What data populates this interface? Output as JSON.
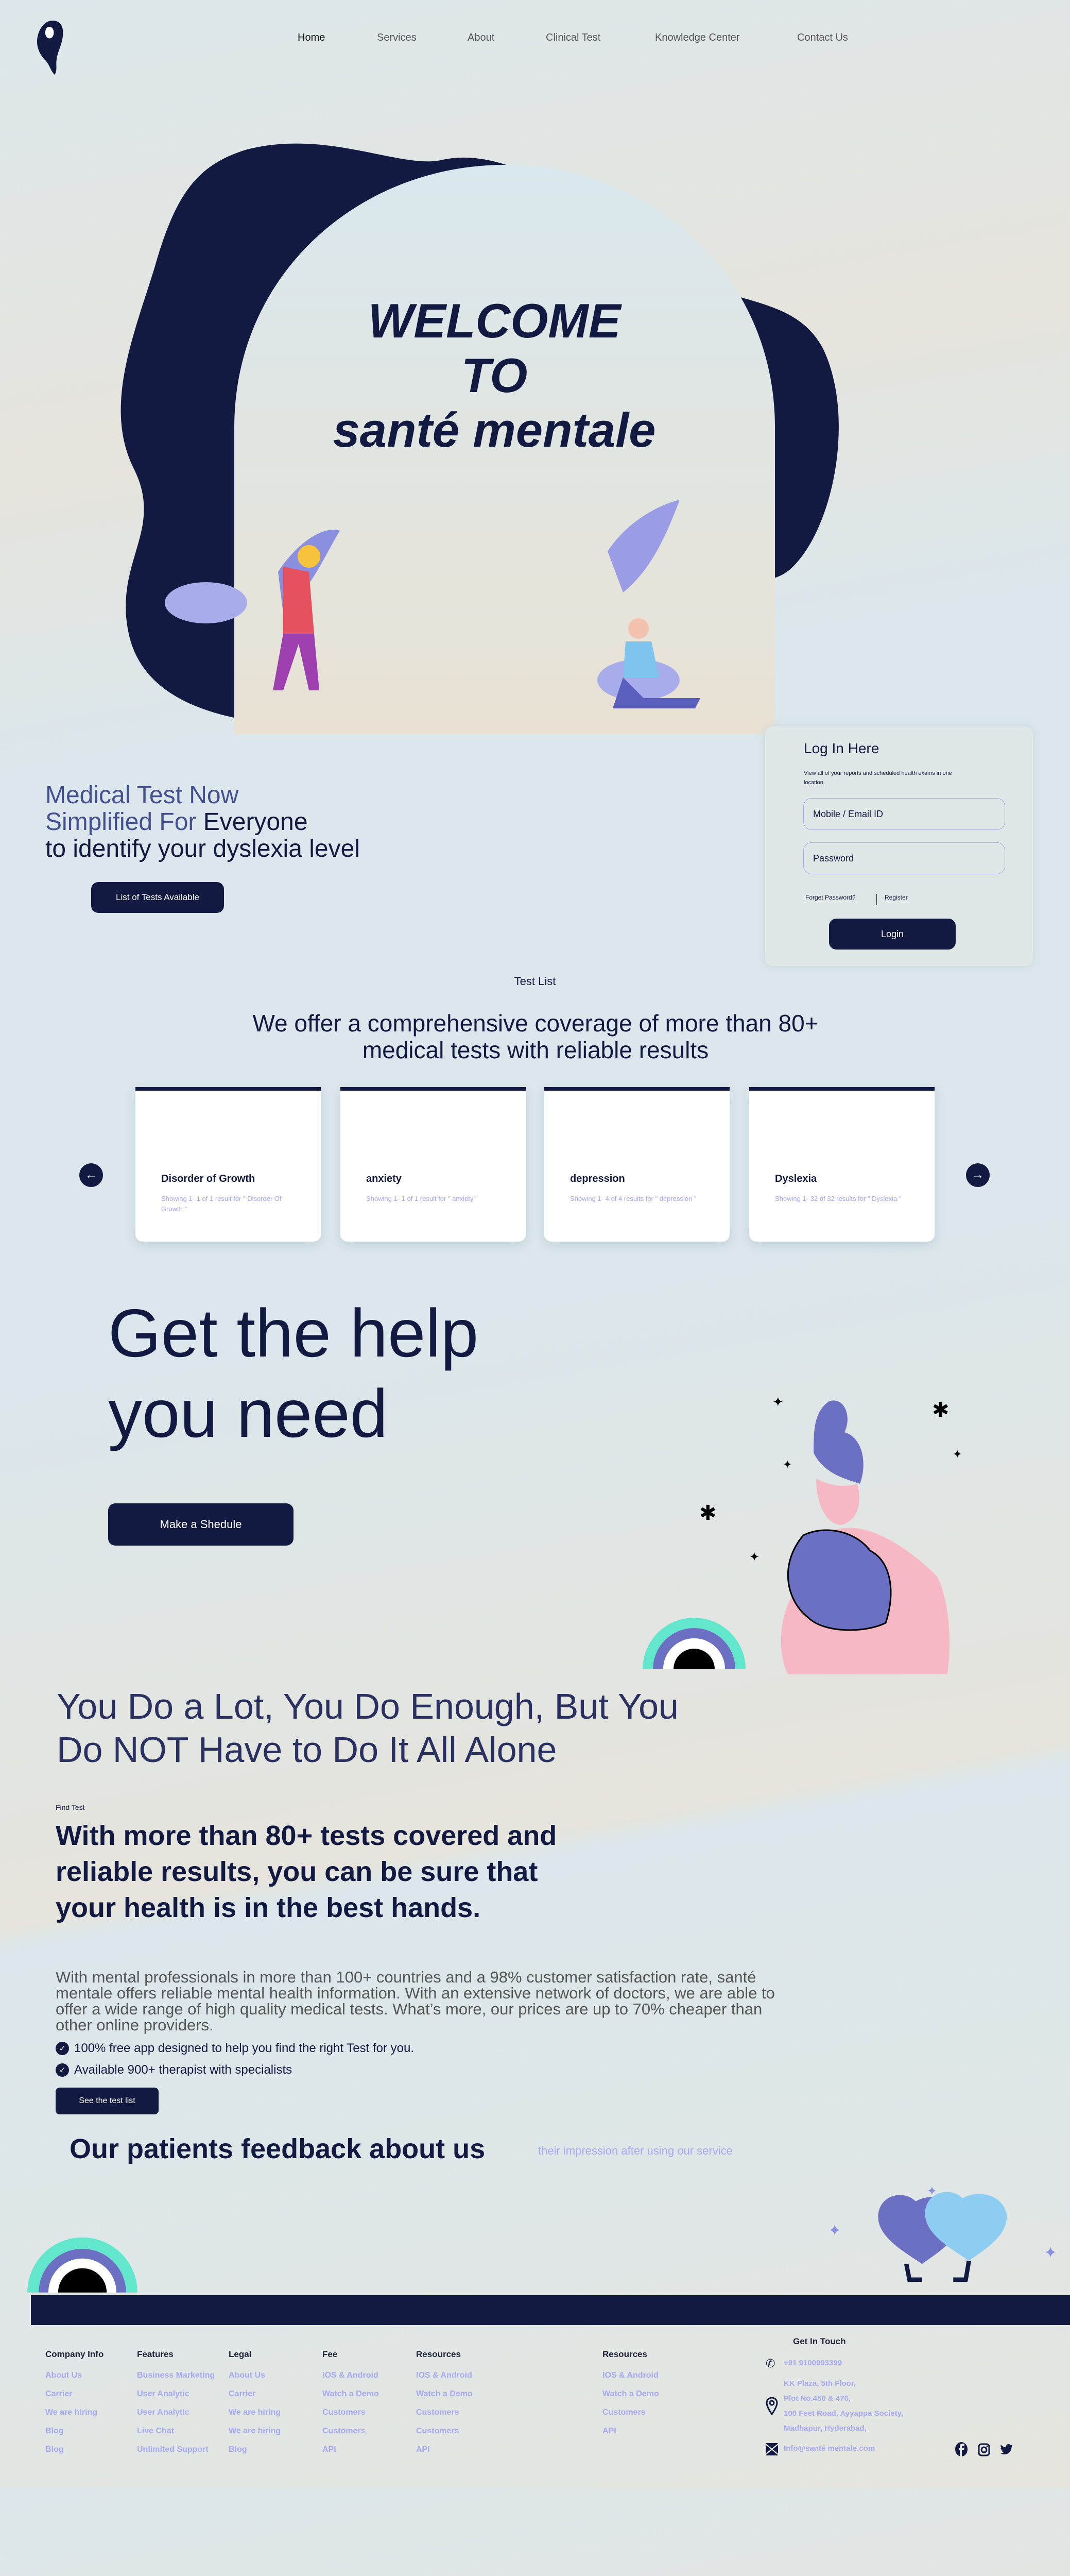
{
  "nav": {
    "items": [
      "Home",
      "Services",
      "About",
      "Clinical Test",
      "Knowledge Center",
      "Contact Us"
    ],
    "active": "Home"
  },
  "hero": {
    "line1": "WELCOME",
    "line2": "TO",
    "line3": "santé mentale"
  },
  "intro": {
    "accent": "Medical Test Now",
    "accent2": "Simplified For",
    "rest": "Everyone",
    "line3": "to identify your dyslexia level",
    "button": "List of Tests Available"
  },
  "login": {
    "title": "Log In Here",
    "subtitle": "View all of your reports and scheduled health exams in one location.",
    "email_placeholder": "Mobile / Email ID",
    "password_placeholder": "Password",
    "forgot": "Forget Password?",
    "register": "Register",
    "button": "Login"
  },
  "tests": {
    "label": "Test List",
    "heading": "We offer a comprehensive coverage of more than 80+ medical tests with reliable results",
    "cards": [
      {
        "title": "Disorder of Growth",
        "summary": "Showing 1- 1 of 1 result for \" Disorder Of Growth \""
      },
      {
        "title": "anxiety",
        "summary": "Showing 1- 1 of 1 result for \" anxiety \""
      },
      {
        "title": "depression",
        "summary": "Showing 1- 4 of 4 results for \" depression \""
      },
      {
        "title": "Dyslexia",
        "summary": "Showing 1- 32 of 32 results for \" Dyslexia \""
      }
    ]
  },
  "help": {
    "line1": "Get the help",
    "line2": "you need",
    "button": "Make a Shedule",
    "tagline": "You Do a Lot, You Do Enough, But You Do NOT Have to Do It All Alone"
  },
  "find": {
    "label": "Find Test",
    "heading": "With more than 80+ tests covered and reliable results, you can be sure that your health is in the best hands.",
    "body": "With mental  professionals in more than 100+ countries and a 98% customer satisfaction rate, santé mentale offers reliable mental health information. With an extensive network of doctors, we are able to offer a wide range of high quality medical tests. What’s more, our prices are up to 70% cheaper than other online providers.",
    "checks": [
      "100% free app designed to help you find the right Test for you.",
      "Available 900+ therapist with  specialists"
    ],
    "button": "See the test list"
  },
  "feedback": {
    "heading": "Our patients feedback about us",
    "subtitle": "their impression after using our service"
  },
  "footer": {
    "columns": [
      {
        "title": "Company Info",
        "items": [
          "About Us",
          "Carrier",
          "We are hiring",
          "Blog",
          "Blog"
        ]
      },
      {
        "title": "Features",
        "items": [
          "Business Marketing",
          "User Analytic",
          "User Analytic",
          "Live Chat",
          "Unlimited Support"
        ]
      },
      {
        "title": "Legal",
        "items": [
          "About Us",
          "Carrier",
          "We are hiring",
          "We are hiring",
          "Blog"
        ]
      },
      {
        "title": "Fee",
        "items": [
          "IOS & Android",
          "Watch a Demo",
          "Customers",
          "Customers",
          "API"
        ]
      },
      {
        "title": "Resources",
        "items": [
          "IOS & Android",
          "Watch a Demo",
          "Customers",
          "Customers",
          "API"
        ]
      },
      {
        "title": "Resources",
        "items": [
          "IOS & Android",
          "Watch a Demo",
          "Customers",
          "API"
        ]
      }
    ],
    "contact": {
      "title": "Get In Touch",
      "phone": "+91 9100993399",
      "address": [
        "KK Plaza, 5th Floor,",
        "Plot No.450 & 476,",
        "100 Feet Road, Ayyappa Society,",
        "Madhapur, Hyderabad,"
      ],
      "email": "Info@santé mentale.com"
    },
    "social": [
      "facebook-icon",
      "instagram-icon",
      "twitter-icon"
    ]
  },
  "colors": {
    "navy": "#131a42",
    "accent": "#45508f",
    "lavender": "#a6a8f0",
    "purple": "#6c70c2",
    "teal": "#62e6cc",
    "pink": "#f6b8c4"
  }
}
